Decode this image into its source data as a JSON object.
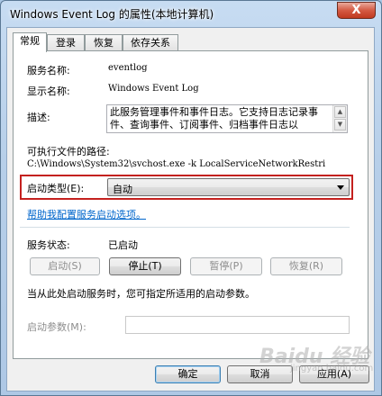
{
  "window": {
    "title": "Windows Event Log 的属性(本地计算机)",
    "close_label": "X"
  },
  "tabs": [
    {
      "label": "常规",
      "active": true
    },
    {
      "label": "登录",
      "active": false
    },
    {
      "label": "恢复",
      "active": false
    },
    {
      "label": "依存关系",
      "active": false
    }
  ],
  "general": {
    "service_name_label": "服务名称:",
    "service_name_value": "eventlog",
    "display_name_label": "显示名称:",
    "display_name_value": "Windows Event Log",
    "description_label": "描述:",
    "description_value": "此服务管理事件和事件日志。它支持日志记录事件、查询事件、订阅事件、归档事件日志以",
    "exe_path_label": "可执行文件的路径:",
    "exe_path_value": "C:\\Windows\\System32\\svchost.exe -k LocalServiceNetworkRestri",
    "startup_type_label": "启动类型(E):",
    "startup_type_value": "自动",
    "help_link": "帮助我配置服务启动选项。",
    "service_status_label": "服务状态:",
    "service_status_value": "已启动",
    "start_button": "启动(S)",
    "stop_button": "停止(T)",
    "pause_button": "暂停(P)",
    "resume_button": "恢复(R)",
    "start_params_hint": "当从此处启动服务时，您可指定所适用的启动参数。",
    "start_params_label": "启动参数(M):",
    "start_params_value": ""
  },
  "footer": {
    "ok_button": "确定",
    "cancel_button": "取消",
    "apply_button": "应用(A)"
  },
  "watermark": {
    "brand": "Baidu 经验",
    "sub": "jingyan.baidu.com"
  }
}
